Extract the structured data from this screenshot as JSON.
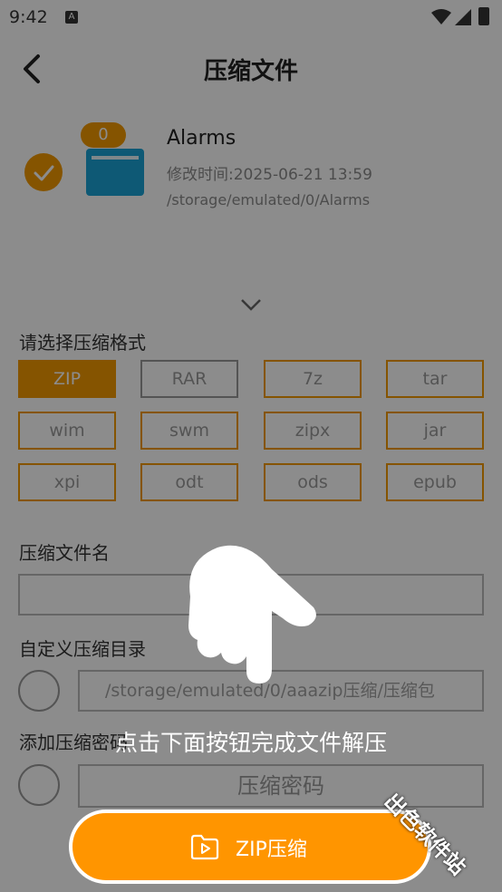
{
  "status_bar": {
    "time": "9:42",
    "notification_letter": "A"
  },
  "header": {
    "title": "压缩文件"
  },
  "file": {
    "count_badge": "0",
    "name": "Alarms",
    "modified": "修改时间:2025-06-21 13:59",
    "path": "/storage/emulated/0/Alarms"
  },
  "format_section": {
    "label": "请选择压缩格式",
    "selected": "ZIP",
    "options": [
      "ZIP",
      "RAR",
      "7z",
      "tar",
      "wim",
      "swm",
      "zipx",
      "jar",
      "xpi",
      "odt",
      "ods",
      "epub"
    ]
  },
  "name_section": {
    "label": "压缩文件名",
    "value": ""
  },
  "dir_section": {
    "label": "自定义压缩目录",
    "placeholder": "/storage/emulated/0/aaazip压缩/压缩包"
  },
  "password_section": {
    "label": "添加压缩密码",
    "placeholder": "压缩密码"
  },
  "overlay": {
    "hint": "点击下面按钮完成文件解压"
  },
  "action_button": {
    "label": "ZIP压缩"
  },
  "watermark": {
    "text": "出色软件站"
  },
  "colors": {
    "accent": "#f29900",
    "button": "#ff9500"
  }
}
